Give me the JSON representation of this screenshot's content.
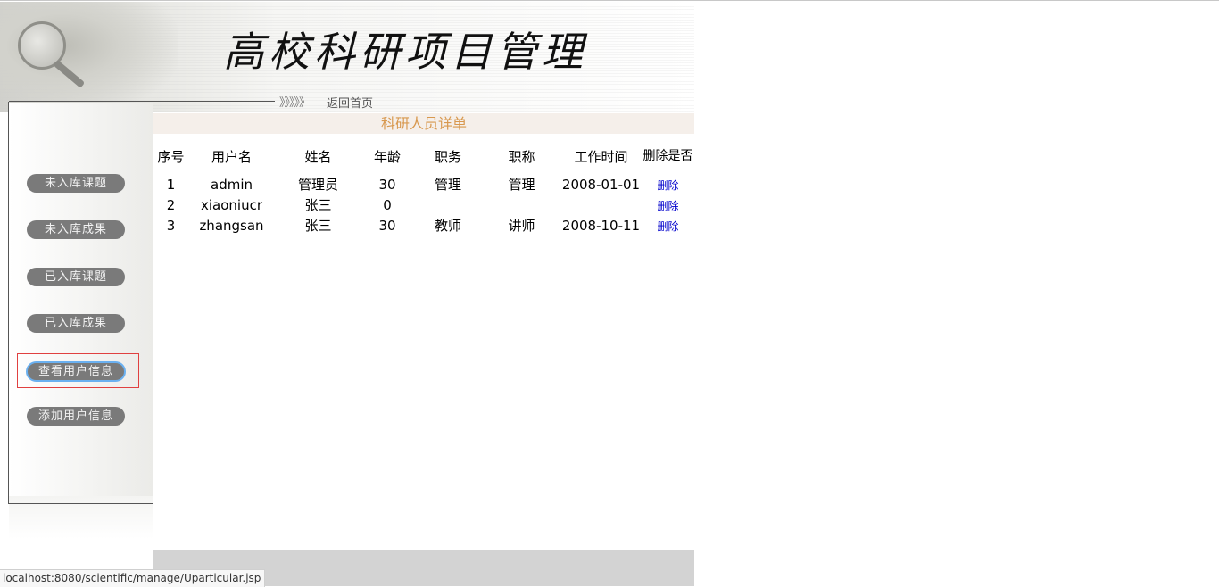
{
  "banner": {
    "title": "高校科研项目管理",
    "chevrons": "》》》》》",
    "home_link": "返回首页"
  },
  "sidebar": {
    "items": [
      {
        "label": "未入库课题"
      },
      {
        "label": "未入库成果"
      },
      {
        "label": "已入库课题"
      },
      {
        "label": "已入库成果"
      },
      {
        "label": "查看用户信息"
      },
      {
        "label": "添加用户信息"
      }
    ]
  },
  "main": {
    "heading": "科研人员详单",
    "columns": [
      "序号",
      "用户名",
      "姓名",
      "年龄",
      "职务",
      "职称",
      "工作时间",
      "删除是否"
    ],
    "rows": [
      {
        "no": "1",
        "username": "admin",
        "name": "管理员",
        "age": "30",
        "duty": "管理",
        "title": "管理",
        "work_time": "2008-01-01",
        "action": "删除"
      },
      {
        "no": "2",
        "username": "xiaoniucr",
        "name": "张三",
        "age": "0",
        "duty": "",
        "title": "",
        "work_time": "",
        "action": "删除"
      },
      {
        "no": "3",
        "username": "zhangsan",
        "name": "张三",
        "age": "30",
        "duty": "教师",
        "title": "讲师",
        "work_time": "2008-10-11",
        "action": "删除"
      }
    ]
  },
  "status_bar": {
    "url": "localhost:8080/scientific/manage/Uparticular.jsp"
  }
}
